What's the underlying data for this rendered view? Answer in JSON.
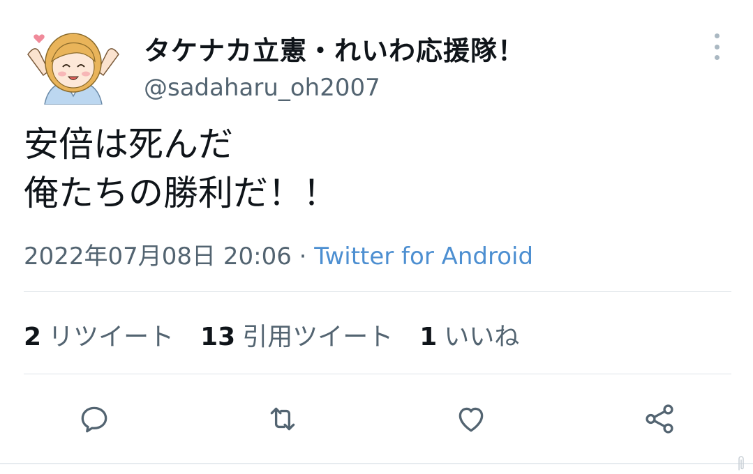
{
  "tweet": {
    "display_name": "タケナカ立憲・れいわ応援隊！",
    "handle": "@sadaharu_oh2007",
    "text_line1": "安倍は死んだ",
    "text_line2": "俺たちの勝利だ！！",
    "timestamp": "2022年07月08日 20:06",
    "separator": "·",
    "source": "Twitter for Android"
  },
  "stats": {
    "retweets_count": "2",
    "retweets_label": "リツイート",
    "quotes_count": "13",
    "quotes_label": "引用ツイート",
    "likes_count": "1",
    "likes_label": "いいね"
  },
  "icons": {
    "reply": "reply-icon",
    "retweet": "retweet-icon",
    "like": "heart-icon",
    "share": "share-icon",
    "more": "more-vertical-icon"
  },
  "colors": {
    "text": "#0f1419",
    "secondary": "#536471",
    "link": "#4d8fd1",
    "divider": "#dde3e8"
  }
}
